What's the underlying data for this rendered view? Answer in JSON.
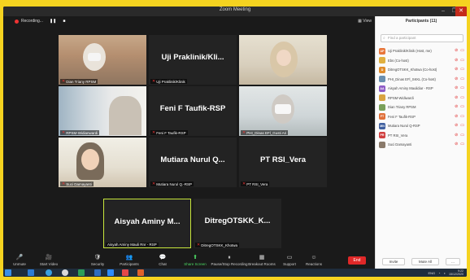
{
  "window": {
    "title": "Zoom Meeting",
    "controls": {
      "minimize": "–",
      "maximize": "❐",
      "close": "✕"
    }
  },
  "topbar": {
    "recording_label": "Recording...",
    "pause_icon": "❚❚",
    "stop_icon": "■",
    "view_label": "View"
  },
  "tiles": [
    {
      "kind": "video",
      "label": "Dian Triany RPSM"
    },
    {
      "kind": "name",
      "name": "Uji Praklinik/Kli...",
      "label": "Uji Praklinik/Klinik"
    },
    {
      "kind": "video",
      "label": ""
    },
    {
      "kind": "video",
      "label": "RPSM-Widianwardi"
    },
    {
      "kind": "name",
      "name": "Feni F Taufik-RSP",
      "label": "Feni F Taufik-RSP"
    },
    {
      "kind": "video",
      "label": "PHI_Dinas EFl_Gusti Ari"
    },
    {
      "kind": "video",
      "label": "Suci Damayanti"
    },
    {
      "kind": "name",
      "name": "Mutiara Nurul Q...",
      "label": "Mutiara Nurul Q.-RSP"
    },
    {
      "kind": "name",
      "name": "PT RSI_Vera",
      "label": "PT RSI_Vera"
    },
    {
      "kind": "name",
      "name": "Aisyah Aminy M...",
      "label": "Aisyah Aminy Mauli Rnr - RSP"
    },
    {
      "kind": "name",
      "name": "DitregOTSKK_K...",
      "label": "DitregOTSKK_Khotwa"
    }
  ],
  "toolbar": {
    "items": [
      {
        "icon": "🎤",
        "label": "Unmute"
      },
      {
        "icon": "🎥",
        "label": "Start Video"
      },
      {
        "icon": "🛡",
        "label": "Security"
      },
      {
        "icon": "👥",
        "label": "Participants"
      },
      {
        "icon": "💬",
        "label": "Chat"
      },
      {
        "icon": "⬆",
        "label": "Share Screen"
      },
      {
        "icon": "⏸",
        "label": "Pause/Stop Recording"
      },
      {
        "icon": "▦",
        "label": "Breakout Rooms"
      },
      {
        "icon": "▭",
        "label": "Support"
      },
      {
        "icon": "☺",
        "label": "Reactions"
      }
    ],
    "end_label": "End",
    "participants_count": "11"
  },
  "sidebar": {
    "title": "Participants (11)",
    "search_placeholder": "Find a participant",
    "participants": [
      {
        "initials": "UP",
        "color": "#e8763a",
        "name": "Uji Praklinik/Klinik (Host, me)"
      },
      {
        "initials": "",
        "color": "#e0b040",
        "name": "Ebs (Co-host)"
      },
      {
        "initials": "D",
        "color": "#e08b2a",
        "name": "DitregOTSKK_Khotwa (Co-host)"
      },
      {
        "initials": "",
        "color": "#6a8fb0",
        "name": "PHI_Dinas EFl_SKKL (Co-host)"
      },
      {
        "initials": "AA",
        "color": "#8e5cc6",
        "name": "Aisyah Aminy Maulidiar - RSP"
      },
      {
        "initials": "",
        "color": "#d9a441",
        "name": "RPSM-Widiwardi"
      },
      {
        "initials": "",
        "color": "#7aa05a",
        "name": "Dian Triany RPSM"
      },
      {
        "initials": "FT",
        "color": "#e0703a",
        "name": "Feni F Taufik-RSP"
      },
      {
        "initials": "MN",
        "color": "#3f5f9f",
        "name": "Mutiara Nurul Q-RSP"
      },
      {
        "initials": "PR",
        "color": "#d04040",
        "name": "PT RSI_Vera"
      },
      {
        "initials": "",
        "color": "#8a7a6a",
        "name": "Suci Damayanti"
      }
    ],
    "footer": {
      "invite": "Invite",
      "mute_all": "Mute All",
      "more": "..."
    }
  },
  "taskbar": {
    "time": "9:22",
    "date": "15/12/2020",
    "lang": "ENG"
  }
}
